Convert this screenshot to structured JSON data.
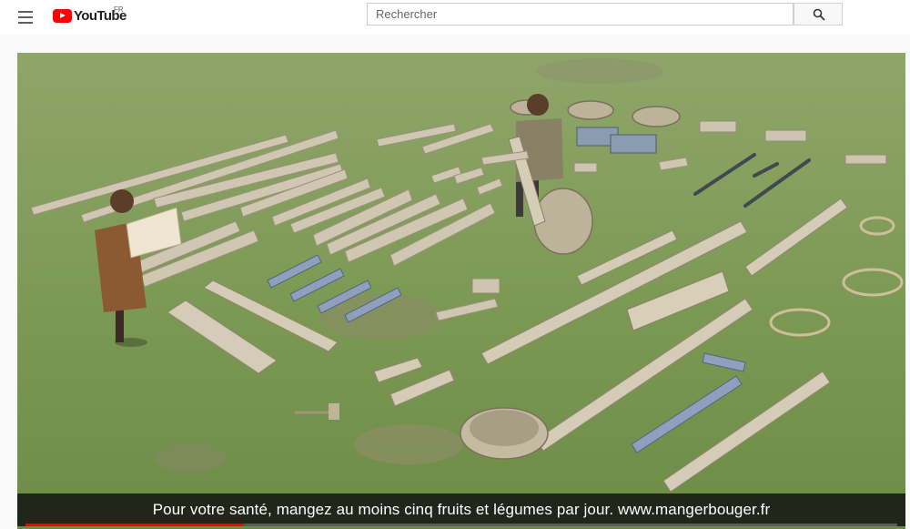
{
  "header": {
    "logo_text": "YouTube",
    "region_code": "FR",
    "search": {
      "placeholder": "Rechercher",
      "value": ""
    }
  },
  "player": {
    "caption": "Pour votre santé, mangez au moins cinq fruits et légumes par jour. www.mangerbouger.fr",
    "progress": 0.25
  },
  "colors": {
    "brand": "#ff0000",
    "grass": "#7a9a52",
    "wood": "#c9c2ad",
    "metal": "#8a9bb5"
  },
  "icons": [
    "menu-icon",
    "youtube-logo-icon",
    "search-icon"
  ]
}
